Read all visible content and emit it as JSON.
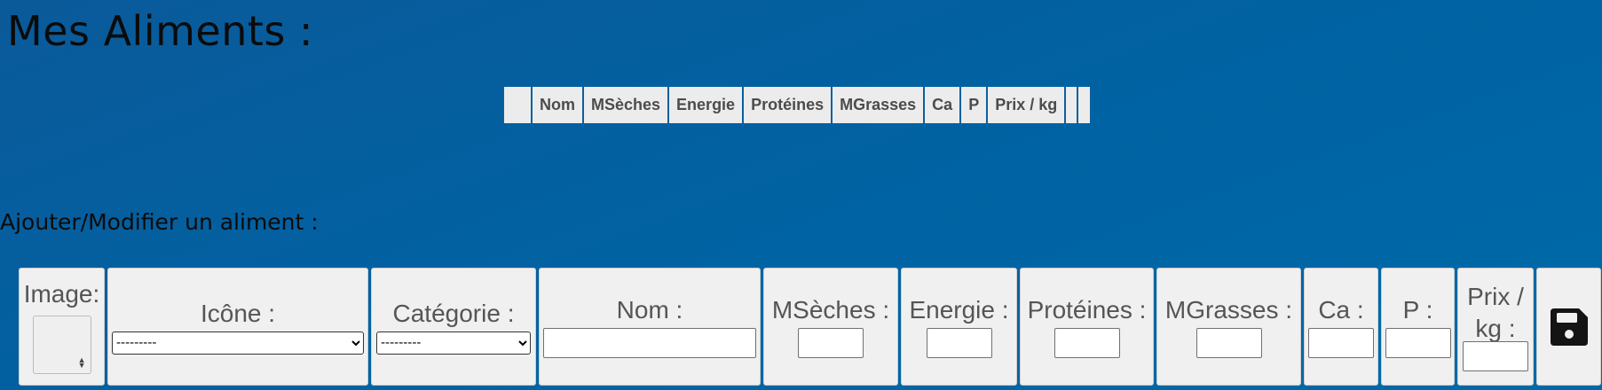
{
  "page": {
    "title": "Mes Aliments :",
    "subtitle": "Ajouter/Modifier un aliment :"
  },
  "table": {
    "headers": [
      "",
      "Nom",
      "MSèches",
      "Energie",
      "Protéines",
      "MGrasses",
      "Ca",
      "P",
      "Prix / kg",
      "",
      ""
    ]
  },
  "form": {
    "image_label": "Image:",
    "icone_label": "Icône :",
    "icone_value": "---------",
    "categorie_label": "Catégorie :",
    "categorie_value": "---------",
    "nom_label": "Nom :",
    "msseches_label": "MSèches :",
    "energie_label": "Energie :",
    "proteines_label": "Protéines :",
    "mgrasses_label": "MGrasses :",
    "ca_label": "Ca :",
    "p_label": "P :",
    "prix_label_line1": "Prix /",
    "prix_label_line2": "kg :",
    "save_icon": "floppy-disk-icon"
  }
}
